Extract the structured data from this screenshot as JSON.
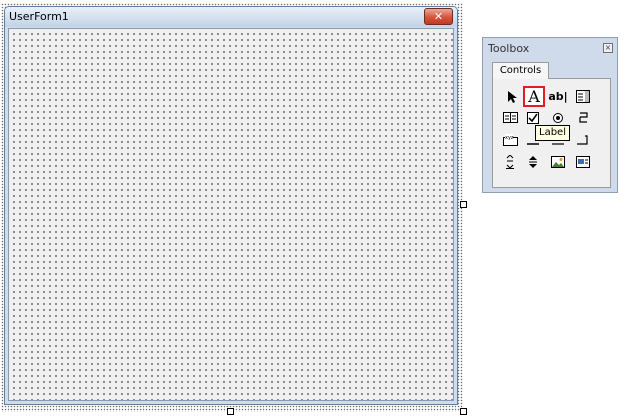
{
  "userform": {
    "title": "UserForm1",
    "close_glyph": "✕"
  },
  "toolbox": {
    "title": "Toolbox",
    "close_glyph": "×",
    "tab_label": "Controls",
    "text_glyph_a": "A",
    "textbox_glyph": "ab|",
    "tooltip": "Label",
    "highlight_color": "#e02020"
  }
}
